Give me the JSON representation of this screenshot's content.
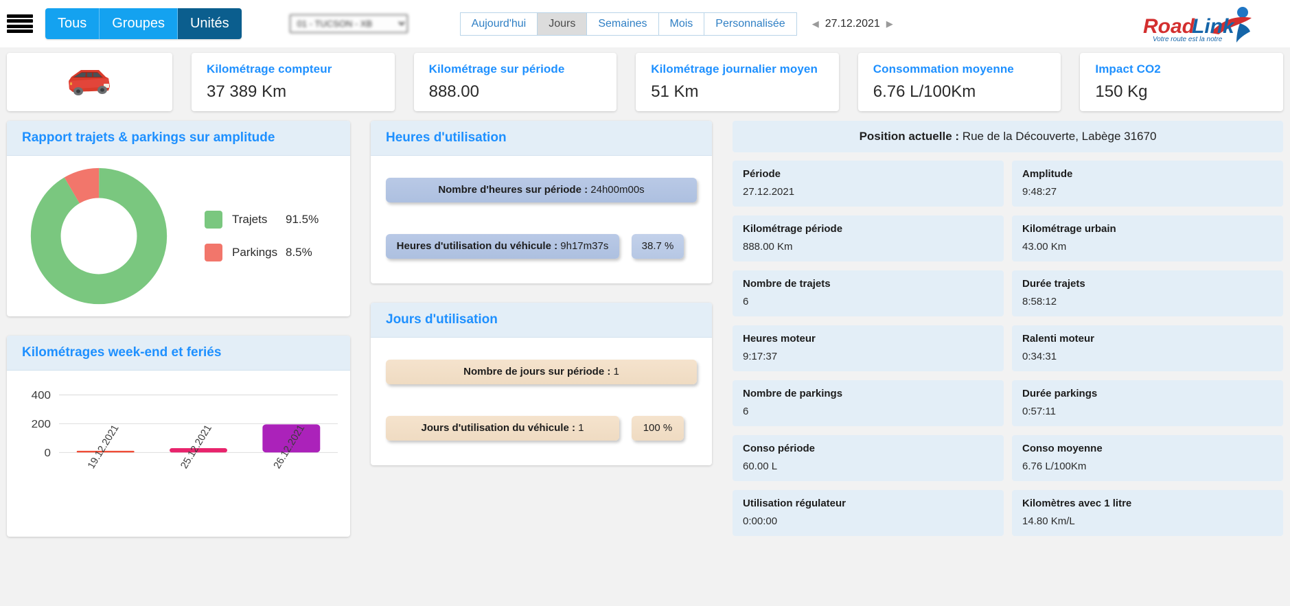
{
  "header": {
    "menu_icon": "hamburger-menu-icon",
    "scope_tabs": [
      {
        "label": "Tous",
        "active": false
      },
      {
        "label": "Groupes",
        "active": false
      },
      {
        "label": "Unités",
        "active": true
      }
    ],
    "unit_select": {
      "value": "01 - TUCSON - XB",
      "blurred": true
    },
    "period_tabs": [
      {
        "label": "Aujourd'hui",
        "active": false
      },
      {
        "label": "Jours",
        "active": true
      },
      {
        "label": "Semaines",
        "active": false
      },
      {
        "label": "Mois",
        "active": false
      },
      {
        "label": "Personnalisée",
        "active": false
      }
    ],
    "date_nav": {
      "prev": "◀",
      "date": "27.12.2021",
      "next": "▶"
    },
    "logo": {
      "name": "RoadLink",
      "part1": "Road",
      "part2": "Link",
      "tagline": "Votre route est la notre"
    }
  },
  "kpis": [
    {
      "label": "Kilométrage compteur",
      "value": "37 389 Km"
    },
    {
      "label": "Kilométrage sur période",
      "value": "888.00"
    },
    {
      "label": "Kilométrage journalier moyen",
      "value": "51 Km"
    },
    {
      "label": "Consommation moyenne",
      "value": "6.76 L/100Km"
    },
    {
      "label": "Impact CO2",
      "value": "150 Kg"
    }
  ],
  "panels": {
    "donut_title": "Rapport trajets & parkings sur amplitude",
    "bar_title": "Kilométrages week-end et feriés",
    "hours_title": "Heures d'utilisation",
    "days_title": "Jours d'utilisation"
  },
  "hours": {
    "total_label": "Nombre d'heures sur période :",
    "total_value": "24h00m00s",
    "vehicle_label": "Heures d'utilisation du véhicule :",
    "vehicle_value": "9h17m37s",
    "percent": "38.7 %"
  },
  "days": {
    "total_label": "Nombre de jours sur période :",
    "total_value": "1",
    "vehicle_label": "Jours d'utilisation du véhicule :",
    "vehicle_value": "1",
    "percent": "100 %"
  },
  "position": {
    "label": "Position actuelle :",
    "value": "Rue de la Découverte, Labège 31670"
  },
  "stats": [
    {
      "label": "Période",
      "value": "27.12.2021"
    },
    {
      "label": "Amplitude",
      "value": "9:48:27"
    },
    {
      "label": "Kilométrage période",
      "value": "888.00 Km"
    },
    {
      "label": "Kilométrage urbain",
      "value": "43.00 Km"
    },
    {
      "label": "Nombre de trajets",
      "value": "6"
    },
    {
      "label": "Durée trajets",
      "value": "8:58:12"
    },
    {
      "label": "Heures moteur",
      "value": "9:17:37"
    },
    {
      "label": "Ralenti moteur",
      "value": "0:34:31"
    },
    {
      "label": "Nombre de parkings",
      "value": "6"
    },
    {
      "label": "Durée parkings",
      "value": "0:57:11"
    },
    {
      "label": "Conso période",
      "value": "60.00 L"
    },
    {
      "label": "Conso moyenne",
      "value": "6.76 L/100Km"
    },
    {
      "label": "Utilisation régulateur",
      "value": "0:00:00"
    },
    {
      "label": "Kilomètres avec 1 litre",
      "value": "14.80 Km/L"
    }
  ],
  "chart_data": [
    {
      "type": "pie",
      "title": "Rapport trajets & parkings sur amplitude",
      "labels": [
        "Trajets",
        "Parkings"
      ],
      "values": [
        91.5,
        8.5
      ],
      "value_labels": [
        "91.5%",
        "8.5%"
      ],
      "colors": [
        "#7ac77f",
        "#f2766b"
      ],
      "donut": true,
      "legend": "right"
    },
    {
      "type": "bar",
      "title": "Kilométrages week-end et feriés",
      "categories": [
        "19.12.2021",
        "25.12.2021",
        "26.12.2021"
      ],
      "values": [
        5,
        30,
        195
      ],
      "colors": [
        "#ef4b35",
        "#e8246c",
        "#ab22ba"
      ],
      "xlabel": "",
      "ylabel": "",
      "ylim": [
        0,
        440
      ],
      "yticks": [
        0,
        200,
        400
      ],
      "grid": true,
      "legend": "none"
    }
  ],
  "colors": {
    "accent_blue": "#1e90ff",
    "tab_blue": "#14a2f0",
    "tab_active_blue": "#0b5e8e",
    "panel_head": "#e3eef7",
    "logo_red": "#d32f2f",
    "logo_blue": "#1565a8"
  }
}
